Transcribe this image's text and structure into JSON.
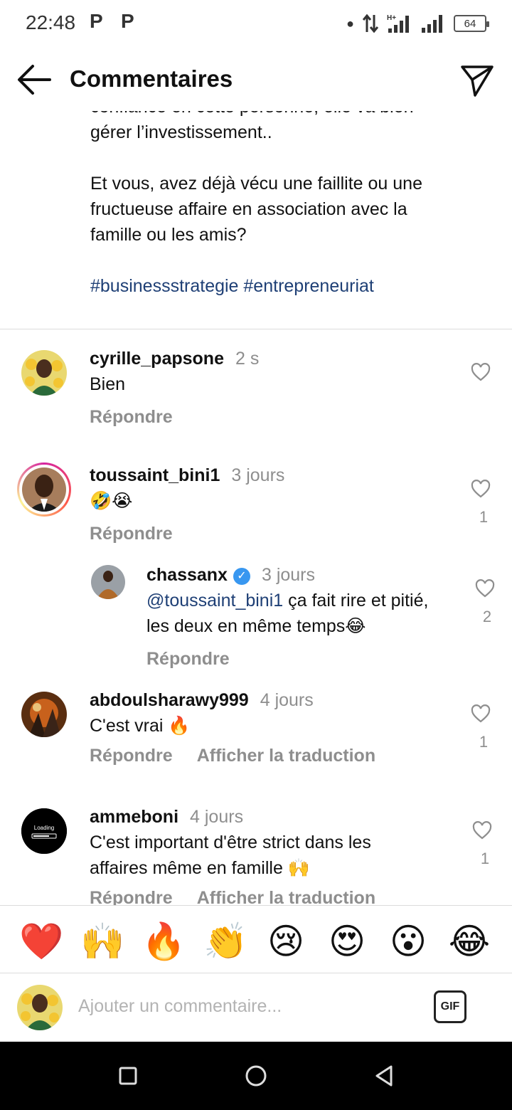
{
  "status_bar": {
    "time": "22:48",
    "notif_icons": [
      "P",
      "P"
    ],
    "battery": "64"
  },
  "header": {
    "title": "Commentaires"
  },
  "caption": {
    "line_partial": "confiance en cette personne, elle va bien",
    "line2": "gérer l’investissement..",
    "paragraph2": "Et vous, avez déjà vécu une faillite ou une fructueuse affaire en association avec la famille ou les amis?",
    "hashtags": "#businessstrategie #entrepreneuriat"
  },
  "comments": [
    {
      "username": "cyrille_papsone",
      "time": "2 s",
      "text": "Bien",
      "reply": "Répondre"
    },
    {
      "username": "toussaint_bini1",
      "time": "3 jours",
      "text": "🤣😭",
      "reply": "Répondre",
      "likes": "1"
    },
    {
      "username": "chassanx",
      "time": "3 jours",
      "mention": "@toussaint_bini1",
      "text": " ça fait rire et pitié, les deux en même temps😂",
      "reply": "Répondre",
      "likes": "2",
      "verified": true
    },
    {
      "username": "abdoulsharawy999",
      "time": "4 jours",
      "text": "C'est vrai 🔥",
      "reply": "Répondre",
      "translate": "Afficher la traduction",
      "likes": "1"
    },
    {
      "username": "ammeboni",
      "time": "4 jours",
      "text": "C'est important d'être strict dans les affaires même en famille 🙌",
      "reply": "Répondre",
      "translate": "Afficher la traduction",
      "likes": "1"
    }
  ],
  "reactions": [
    "❤️",
    "🙌",
    "🔥",
    "👏",
    "😢",
    "😍",
    "😮",
    "😂"
  ],
  "composer": {
    "placeholder": "Ajouter un commentaire...",
    "gif_label": "GIF"
  },
  "colors": {
    "mention": "#1e3f75",
    "muted": "#8e8e8e",
    "divider": "#dbdbdb"
  }
}
